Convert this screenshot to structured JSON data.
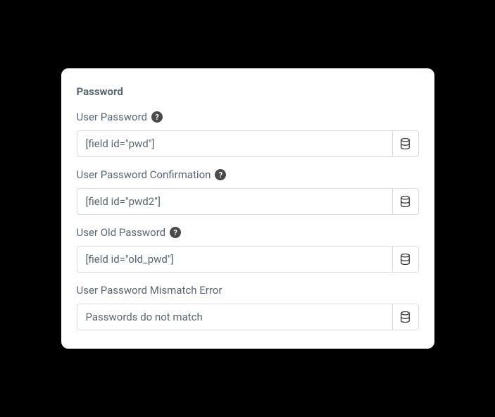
{
  "section": {
    "title": "Password"
  },
  "fields": {
    "user_password": {
      "label": "User Password",
      "value": "[field id=\"pwd\"]",
      "has_help": true
    },
    "user_password_confirmation": {
      "label": "User Password Confirmation",
      "value": "[field id=\"pwd2\"]",
      "has_help": true
    },
    "user_old_password": {
      "label": "User Old Password",
      "value": "[field id=\"old_pwd\"]",
      "has_help": true
    },
    "user_password_mismatch": {
      "label": "User Password Mismatch Error",
      "value": "Passwords do not match",
      "has_help": false
    }
  },
  "icons": {
    "help_glyph": "?"
  }
}
